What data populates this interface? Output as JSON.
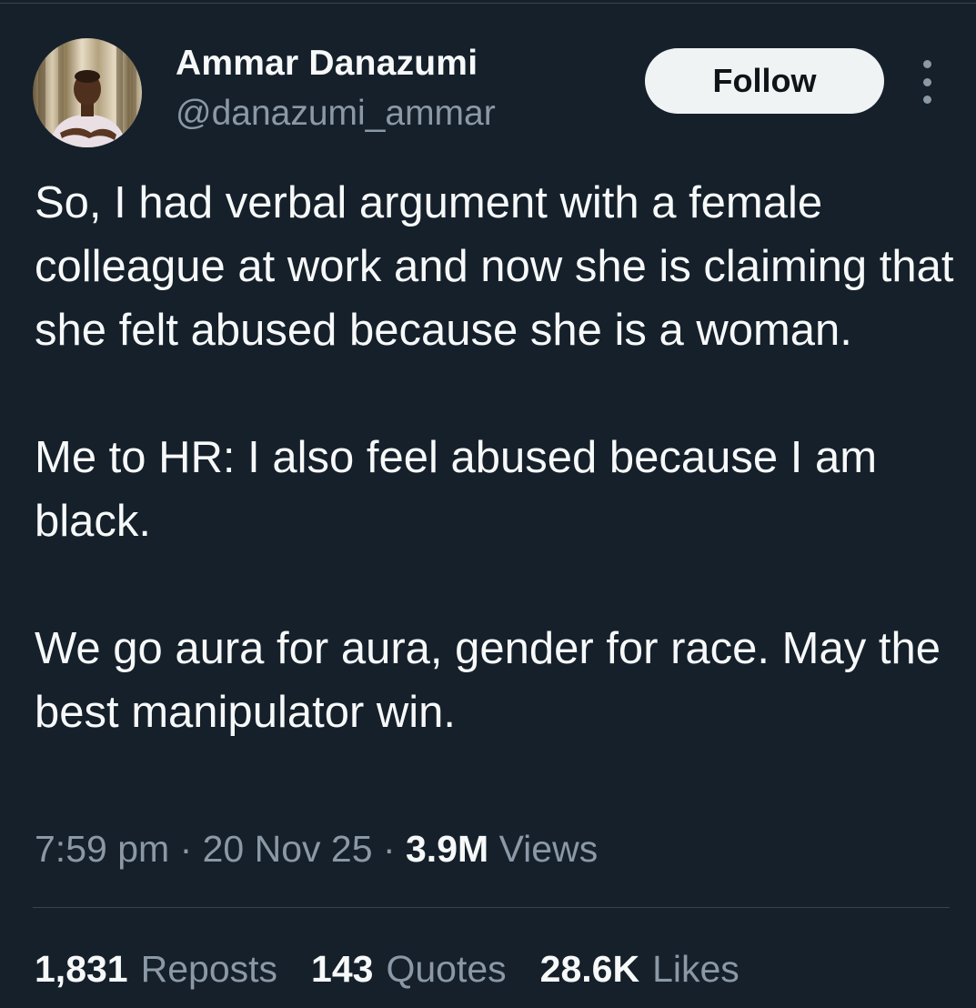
{
  "author": {
    "display_name": "Ammar Danazumi",
    "handle": "@danazumi_ammar",
    "avatar_icon": "profile-photo"
  },
  "actions": {
    "follow_label": "Follow",
    "more_icon": "more-options-icon"
  },
  "tweet": {
    "paragraphs": [
      "So, I had verbal argument with a female colleague at work and now she is claiming that she felt abused because she is a woman.",
      "Me to HR: I also feel abused because I am black.",
      "We go aura for aura, gender for race. May the best manipulator win."
    ],
    "time": "7:59 pm",
    "date": "20 Nov 25",
    "separator": "·",
    "views_count": "3.9M",
    "views_label": "Views"
  },
  "stats": [
    {
      "count": "1,831",
      "label": "Reposts"
    },
    {
      "count": "143",
      "label": "Quotes"
    },
    {
      "count": "28.6K",
      "label": "Likes"
    }
  ],
  "colors": {
    "background": "#15202b",
    "text": "#f7f9f9",
    "secondary_text": "#8b98a5",
    "follow_button": "#eff3f4",
    "divider": "#38444d"
  }
}
